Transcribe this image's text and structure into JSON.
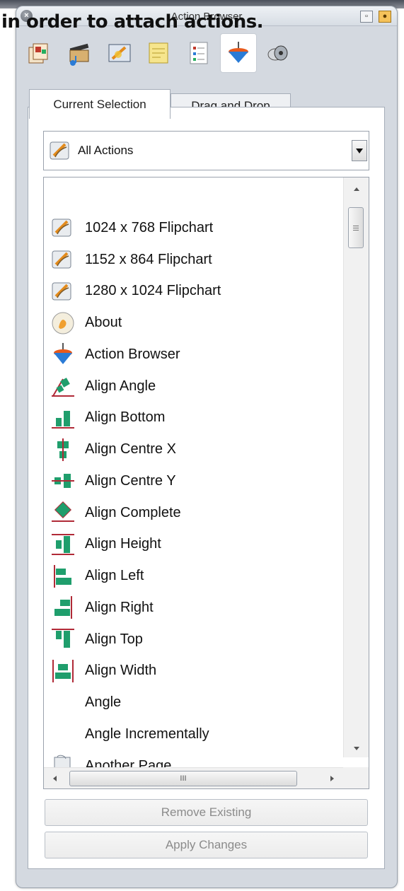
{
  "caption": "in order to attach actions.",
  "window": {
    "title": "Action Browser"
  },
  "toolbar": {
    "icons": [
      "pages-icon",
      "resources-icon",
      "flipchart-icon",
      "notes-icon",
      "properties-icon",
      "action-browser-icon",
      "observations-icon"
    ],
    "active_index": 5
  },
  "tabs": [
    {
      "label": "Current Selection",
      "active": true
    },
    {
      "label": "Drag and Drop",
      "active": false
    }
  ],
  "dropdown": {
    "selected": "All Actions"
  },
  "actions": [
    {
      "label": "1024 x 768 Flipchart",
      "icon": "flipchart-icon"
    },
    {
      "label": "1152 x 864 Flipchart",
      "icon": "flipchart-icon"
    },
    {
      "label": "1280 x 1024 Flipchart",
      "icon": "flipchart-icon"
    },
    {
      "label": "About",
      "icon": "about-icon"
    },
    {
      "label": "Action Browser",
      "icon": "action-browser-icon"
    },
    {
      "label": "Align Angle",
      "icon": "align-angle-icon"
    },
    {
      "label": "Align Bottom",
      "icon": "align-bottom-icon"
    },
    {
      "label": "Align Centre X",
      "icon": "align-centre-x-icon"
    },
    {
      "label": "Align Centre Y",
      "icon": "align-centre-y-icon"
    },
    {
      "label": "Align Complete",
      "icon": "align-complete-icon"
    },
    {
      "label": "Align Height",
      "icon": "align-height-icon"
    },
    {
      "label": "Align Left",
      "icon": "align-left-icon"
    },
    {
      "label": "Align Right",
      "icon": "align-right-icon"
    },
    {
      "label": "Align Top",
      "icon": "align-top-icon"
    },
    {
      "label": "Align Width",
      "icon": "align-width-icon"
    },
    {
      "label": "Angle",
      "icon": ""
    },
    {
      "label": "Angle Incrementally",
      "icon": ""
    },
    {
      "label": "Another Page",
      "icon": "another-page-icon"
    }
  ],
  "scrollbar": {
    "hthumb_glyph": "III"
  },
  "buttons": {
    "remove": "Remove Existing",
    "apply": "Apply Changes"
  },
  "colors": {
    "align_green": "#1f9e6c",
    "align_red": "#b02a37",
    "panel_bg": "#d4d9e0"
  }
}
